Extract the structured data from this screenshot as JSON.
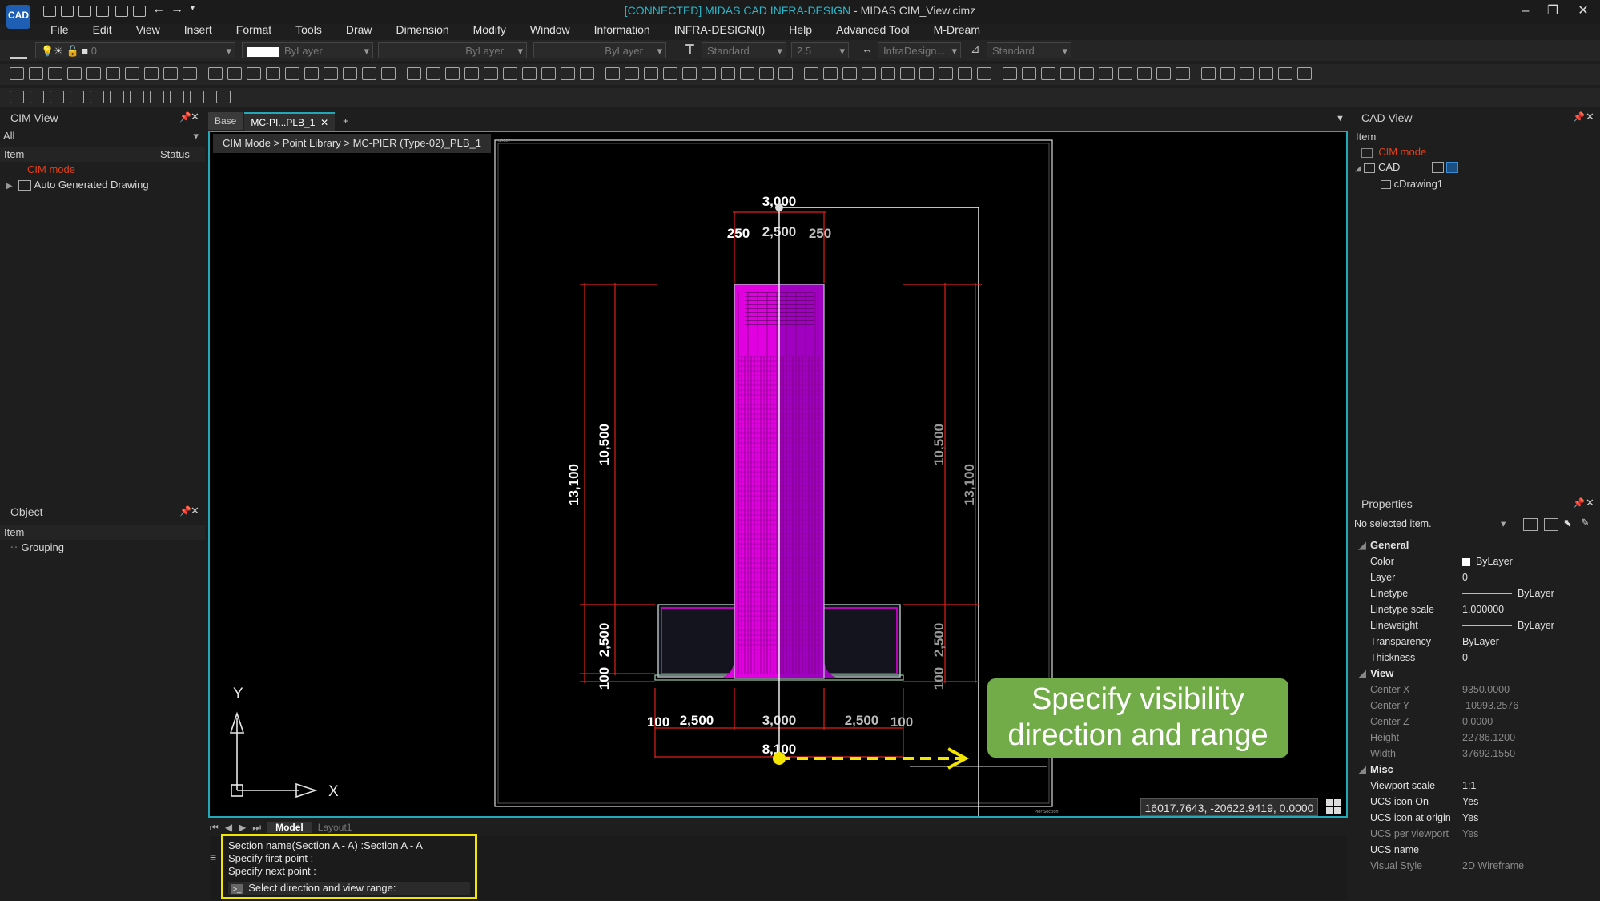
{
  "app": {
    "logo": "CAD",
    "title_connected": "[CONNECTED] MIDAS CAD INFRA-DESIGN",
    "title_rest": " - MIDAS CIM_View.cimz"
  },
  "menu": [
    "File",
    "Edit",
    "View",
    "Insert",
    "Format",
    "Tools",
    "Draw",
    "Dimension",
    "Modify",
    "Window",
    "Information",
    "INFRA-DESIGN(I)",
    "Help",
    "Advanced Tool",
    "M-Dream"
  ],
  "toolbar": {
    "layer_value": "0",
    "color_value": "ByLayer",
    "linetype_value": "ByLayer",
    "lineweight_value": "ByLayer",
    "textstyle_value": "Standard",
    "textheight_value": "2.5",
    "dimstyle_value": "InfraDesign...",
    "tablestyle_value": "Standard"
  },
  "cim_view": {
    "title": "CIM View",
    "filter": "All",
    "col_item": "Item",
    "col_status": "Status",
    "items": [
      "CIM mode",
      "Auto Generated Drawing"
    ]
  },
  "object_panel": {
    "title": "Object",
    "col_item": "Item",
    "items": [
      "Grouping"
    ]
  },
  "doc_tabs": [
    "Base",
    "MC-PI...PLB_1",
    "+"
  ],
  "breadcrumb": "CIM Mode > Point Library > MC-PIER (Type-02)_PLB_1",
  "drawing": {
    "dims_top": [
      "3,000",
      "250",
      "2,500",
      "250"
    ],
    "dims_left": [
      "13,100",
      "10,500",
      "2,500",
      "100"
    ],
    "dims_right": [
      "10,500",
      "13,100",
      "2,500",
      "100"
    ],
    "dims_bottom": [
      "100",
      "2,500",
      "3,000",
      "2,500",
      "100",
      "8,100"
    ],
    "axis_y": "Y",
    "axis_x": "X"
  },
  "callout": {
    "line1": "Specify visibility",
    "line2": "direction and range"
  },
  "coords": "16017.7643, -20622.9419, 0.0000",
  "layout_tabs": [
    "Model",
    "Layout1"
  ],
  "command": {
    "history": [
      "Section name(Section A - A) :Section A - A",
      "Specify first point :",
      "Specify next point :"
    ],
    "prompt": "Select direction and view range:"
  },
  "cad_view": {
    "title": "CAD View",
    "col_item": "Item",
    "items": [
      "CIM mode",
      "CAD",
      "cDrawing1"
    ]
  },
  "properties": {
    "title": "Properties",
    "selection": "No selected item.",
    "sections": [
      {
        "name": "General",
        "rows": [
          {
            "k": "Color",
            "v": "ByLayer",
            "swatch": true
          },
          {
            "k": "Layer",
            "v": "0"
          },
          {
            "k": "Linetype",
            "v": "ByLayer",
            "line": true
          },
          {
            "k": "Linetype scale",
            "v": "1.000000"
          },
          {
            "k": "Lineweight",
            "v": "ByLayer",
            "line": true
          },
          {
            "k": "Transparency",
            "v": "ByLayer"
          },
          {
            "k": "Thickness",
            "v": "0"
          }
        ]
      },
      {
        "name": "View",
        "rows": [
          {
            "k": "Center X",
            "v": "9350.0000",
            "dim": true
          },
          {
            "k": "Center Y",
            "v": "-10993.2576",
            "dim": true
          },
          {
            "k": "Center Z",
            "v": "0.0000",
            "dim": true
          },
          {
            "k": "Height",
            "v": "22786.1200",
            "dim": true
          },
          {
            "k": "Width",
            "v": "37692.1550",
            "dim": true
          }
        ]
      },
      {
        "name": "Misc",
        "rows": [
          {
            "k": "Viewport scale",
            "v": "1:1"
          },
          {
            "k": "UCS icon On",
            "v": "Yes"
          },
          {
            "k": "UCS icon at origin",
            "v": "Yes"
          },
          {
            "k": "UCS per viewport",
            "v": "Yes",
            "dim": true
          },
          {
            "k": "UCS name",
            "v": ""
          },
          {
            "k": "Visual Style",
            "v": "2D Wireframe",
            "dim": true
          }
        ]
      }
    ]
  },
  "colors": {
    "accent": "#22a8b8",
    "magenta": "#e000e0",
    "dim_red": "#e0201a",
    "callout": "#72ac48",
    "highlight": "#f2e600",
    "cim_mode": "#e0401a"
  }
}
